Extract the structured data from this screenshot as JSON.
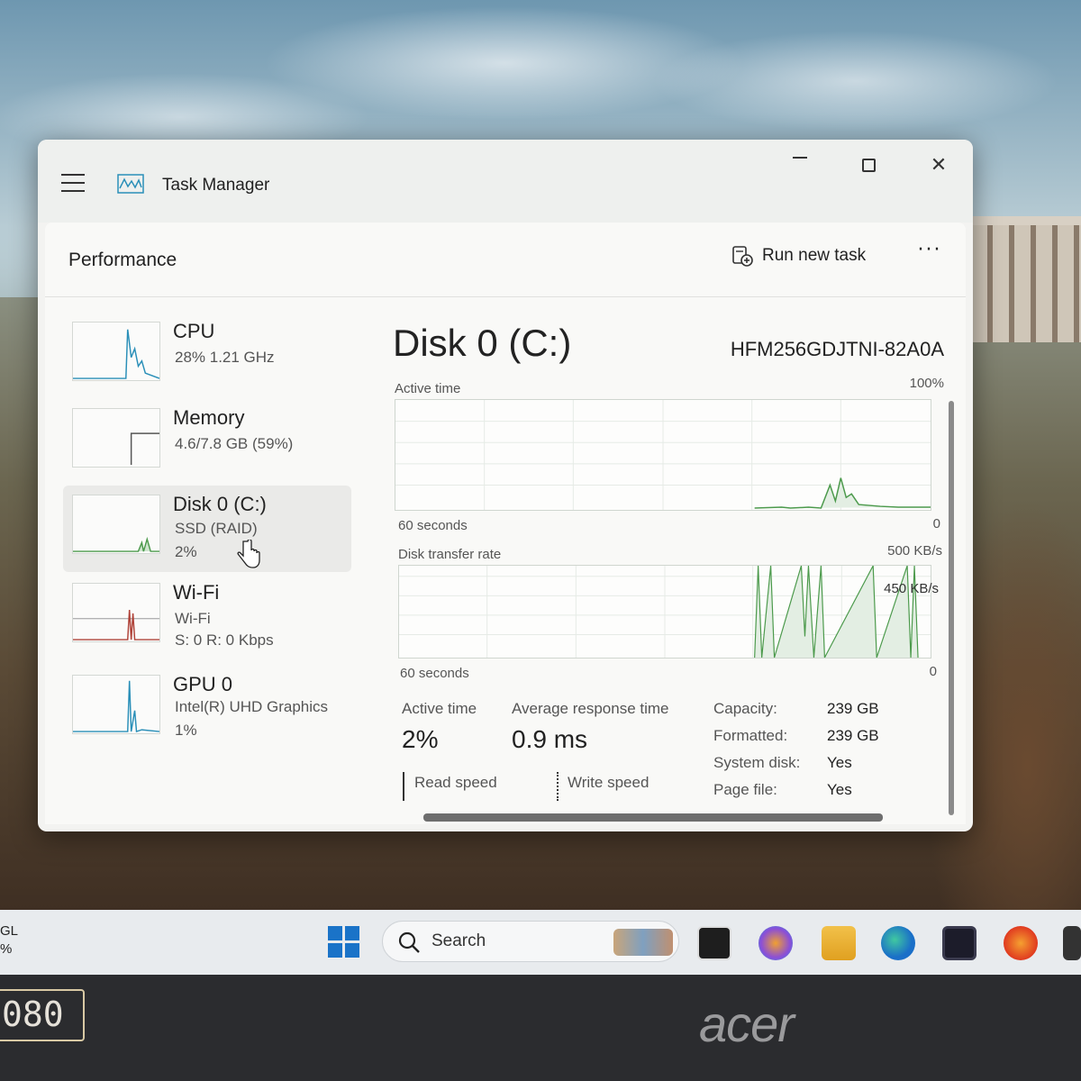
{
  "window": {
    "title": "Task Manager",
    "section": "Performance",
    "run_new_task": "Run new task",
    "more": "···"
  },
  "sidebar": {
    "items": [
      {
        "name": "CPU",
        "sub1": "28%  1.21 GHz",
        "sub2": ""
      },
      {
        "name": "Memory",
        "sub1": "4.6/7.8 GB (59%)",
        "sub2": ""
      },
      {
        "name": "Disk 0 (C:)",
        "sub1": "SSD (RAID)",
        "sub2": "2%"
      },
      {
        "name": "Wi-Fi",
        "sub1": "Wi-Fi",
        "sub2": "S: 0  R: 0 Kbps"
      },
      {
        "name": "GPU 0",
        "sub1": "Intel(R) UHD Graphics",
        "sub2": "1%"
      }
    ],
    "selected_index": 2
  },
  "main": {
    "title": "Disk 0 (C:)",
    "model": "HFM256GDJTNI-82A0A",
    "active_graph": {
      "label": "Active time",
      "max": "100%",
      "duration": "60 seconds",
      "min": "0"
    },
    "transfer_graph": {
      "label": "Disk transfer rate",
      "max": "500 KB/s",
      "mid": "450 KB/s",
      "duration": "60 seconds",
      "min": "0"
    },
    "stats": {
      "active_time_label": "Active time",
      "active_time_value": "2%",
      "avg_response_label": "Average response time",
      "avg_response_value": "0.9 ms",
      "read_speed_label": "Read speed",
      "write_speed_label": "Write speed"
    },
    "info": [
      {
        "key": "Capacity:",
        "value": "239 GB"
      },
      {
        "key": "Formatted:",
        "value": "239 GB"
      },
      {
        "key": "System disk:",
        "value": "Yes"
      },
      {
        "key": "Page file:",
        "value": "Yes"
      }
    ]
  },
  "taskbar": {
    "left_widget_line1": "GL",
    "left_widget_line2": "%",
    "search_text": "Search"
  },
  "bezel": {
    "badge": "080",
    "brand": "acer"
  },
  "colors": {
    "accent": "#1a73c8",
    "disk_graph": "#4c9a4c",
    "cpu_graph": "#2a8fb8",
    "wifi_graph": "#b0443a"
  }
}
